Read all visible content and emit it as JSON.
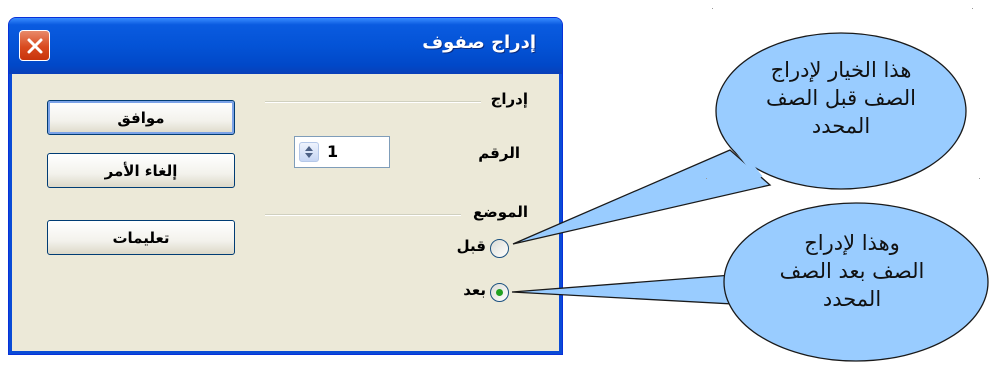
{
  "dialog": {
    "title": "إدراج صفوف",
    "buttons": {
      "ok": "موافق",
      "cancel": "إلغاء الأمر",
      "help": "تعليمات"
    },
    "insert_group": {
      "label": "إدراج",
      "number_label": "الرقم",
      "number_value": "1"
    },
    "position_group": {
      "label": "الموضع",
      "before_label": "قبل",
      "after_label": "بعد",
      "selected": "after"
    }
  },
  "callouts": {
    "before": [
      "هذا الخيار لإدراج",
      "الصف قبل الصف",
      "المحدد"
    ],
    "after": [
      "وهذا لإدراج",
      "الصف بعد الصف",
      "المحدد"
    ]
  },
  "colors": {
    "titlebar": "#0453d6",
    "dialog_bg": "#ece9d8",
    "callout_fill": "#99ccff",
    "callout_stroke": "#1a1a1a",
    "radio_selected": "#21a121"
  }
}
